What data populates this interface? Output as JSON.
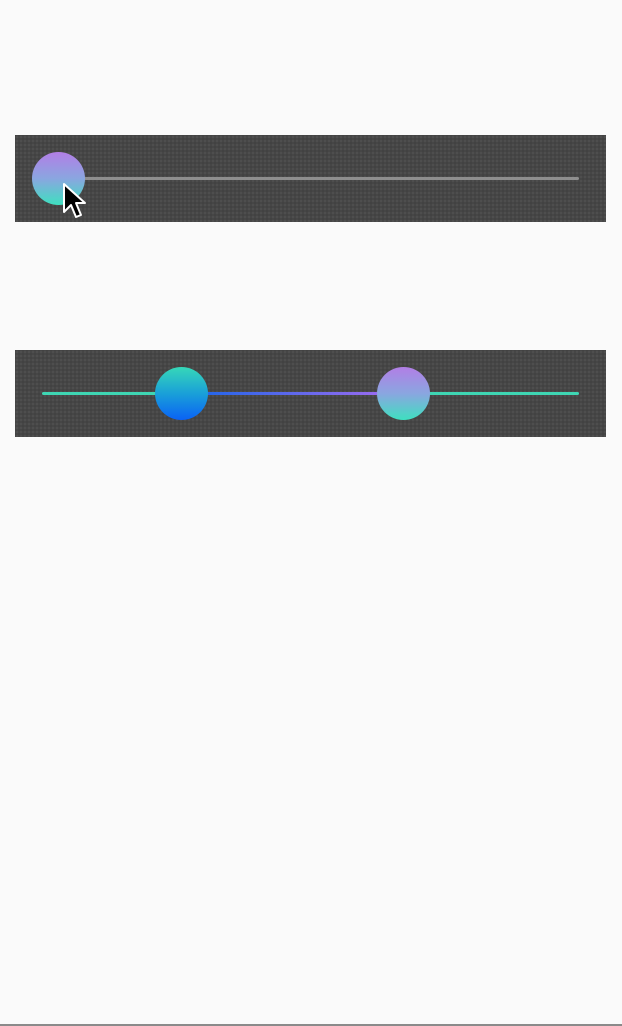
{
  "sliders": {
    "single": {
      "value_fraction": 0.0,
      "thumb_gradient": [
        "#b27ee6",
        "#3ee0c0"
      ],
      "track_color": "#8e8e8e"
    },
    "range": {
      "low_fraction": 0.233,
      "high_fraction": 0.654,
      "low_thumb_gradient": [
        "#36d8b8",
        "#0a62f5"
      ],
      "high_thumb_gradient": [
        "#b27ee6",
        "#3ee0c0"
      ],
      "track_color": "#3ed6b3",
      "range_gradient": [
        "#1565e8",
        "#a76cf0"
      ]
    }
  },
  "colors": {
    "page_background": "#fafafa",
    "panel_background": "#464646"
  },
  "icons": {
    "cursor": "arrow-cursor-icon"
  }
}
